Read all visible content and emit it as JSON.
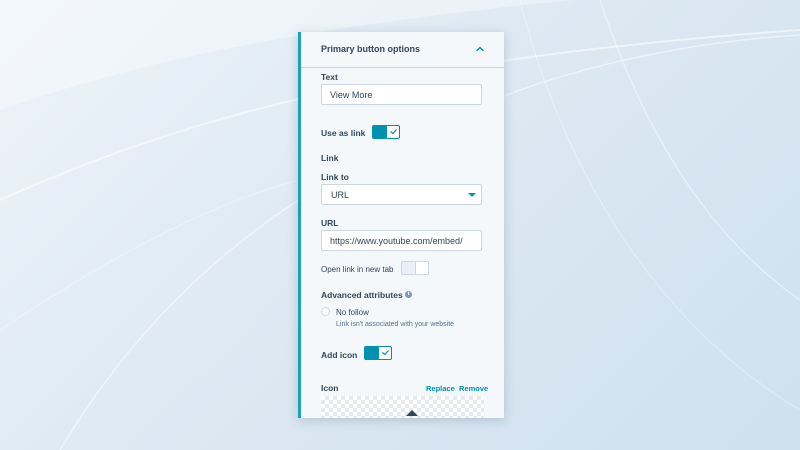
{
  "panel": {
    "title": "Primary button options"
  },
  "fields": {
    "text_label": "Text",
    "text_value": "View More",
    "use_as_link_label": "Use as link",
    "use_as_link_on": true,
    "link_section": "Link",
    "link_to_label": "Link to",
    "link_to_value": "URL",
    "url_label": "URL",
    "url_value": "https://www.youtube.com/embed/",
    "new_tab_label": "Open link in new tab",
    "new_tab_on": false,
    "advanced_label": "Advanced attributes",
    "no_follow_label": "No follow",
    "no_follow_hint": "Link isn't associated with your website",
    "add_icon_label": "Add icon",
    "add_icon_on": true,
    "icon_label": "Icon",
    "replace_label": "Replace",
    "remove_label": "Remove"
  },
  "colors": {
    "accent": "#0091ae",
    "text": "#33475b",
    "border": "#cbd6e2"
  },
  "icons": {
    "collapse": "chevron-up-icon",
    "dropdown": "caret-down-icon",
    "info": "info-icon",
    "check": "check-icon"
  }
}
